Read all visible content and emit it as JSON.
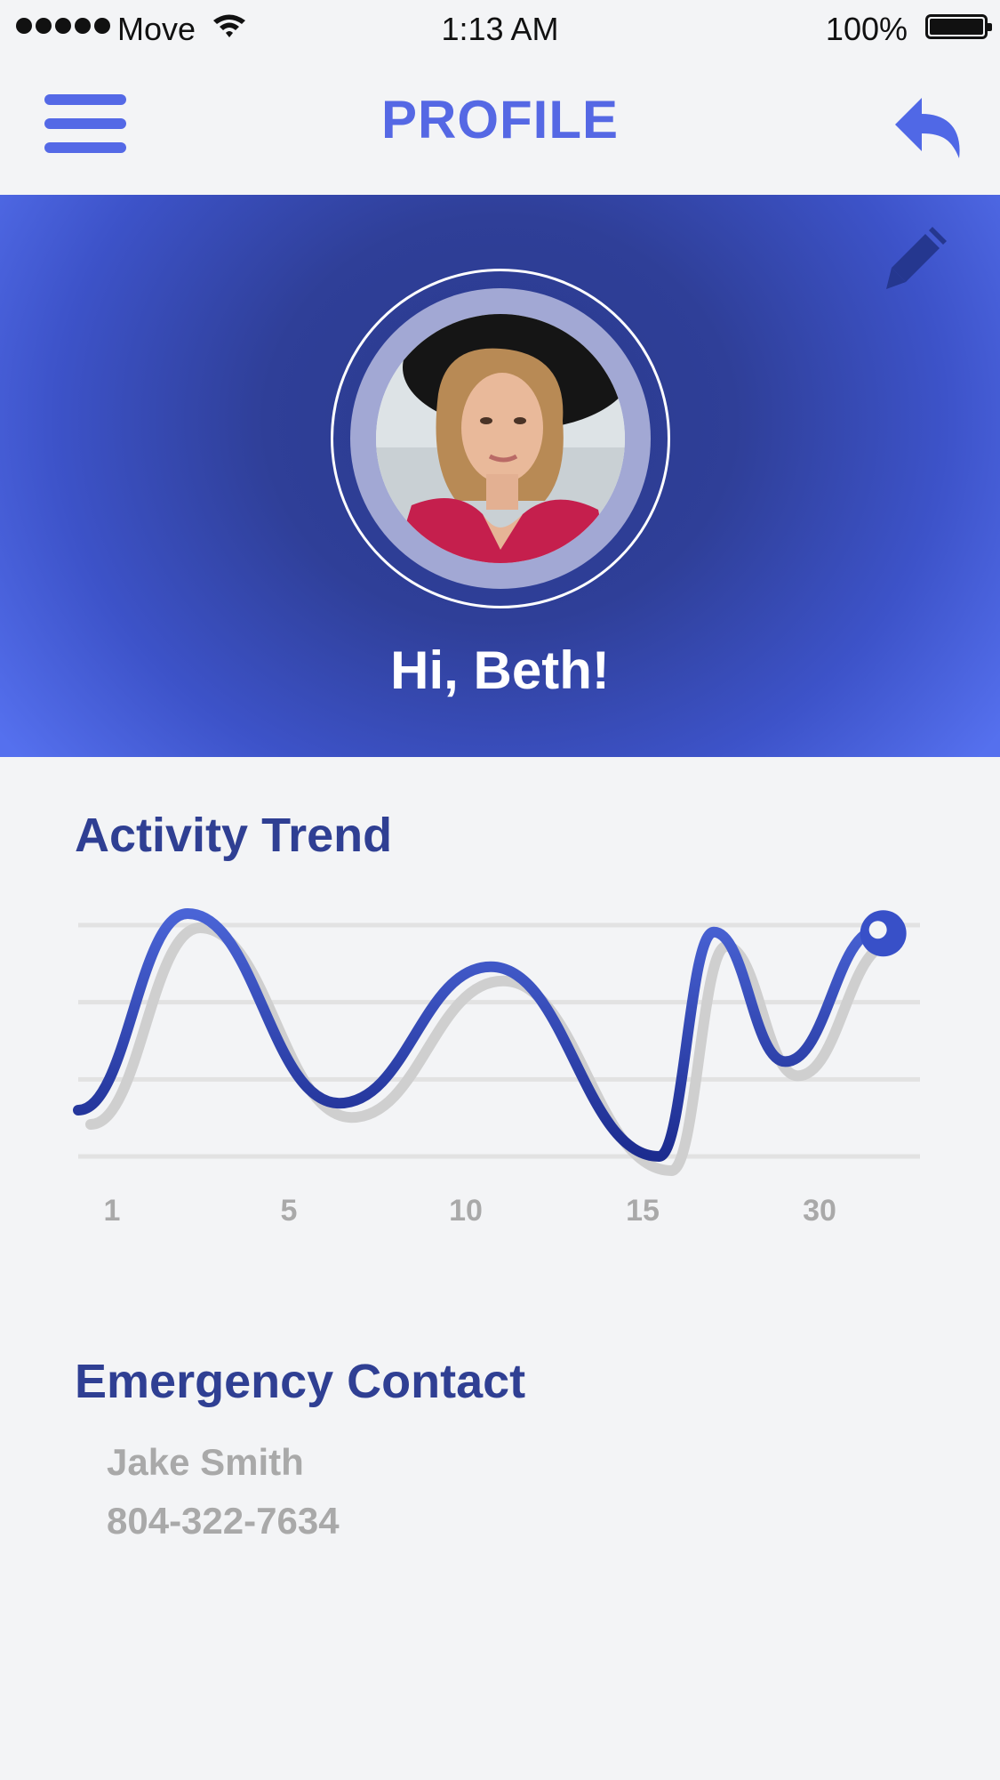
{
  "status_bar": {
    "carrier": "Move",
    "time": "1:13 AM",
    "battery": "100%"
  },
  "nav": {
    "title": "PROFILE",
    "menu_icon": "hamburger-icon",
    "back_icon": "reply-arrow-icon"
  },
  "profile": {
    "greeting": "Hi, Beth!",
    "edit_icon": "pencil-icon",
    "avatar_alt": "profile photo"
  },
  "activity": {
    "title": "Activity Trend"
  },
  "chart_data": {
    "type": "line",
    "x_ticks": [
      "1",
      "5",
      "10",
      "15",
      "30"
    ],
    "series": [
      {
        "x": [
          0,
          0.13,
          0.31,
          0.49,
          0.69,
          0.755,
          0.84,
          0.95
        ],
        "values": [
          0.2,
          1.05,
          0.23,
          0.82,
          0.0,
          0.97,
          0.41,
          0.98
        ]
      }
    ],
    "ylim": [
      0,
      1
    ],
    "grid": true,
    "line_color_start": "#1c2c8f",
    "line_color_end": "#4a64d6",
    "shadow_color": "#cfcfcf"
  },
  "emergency": {
    "title": "Emergency Contact",
    "name": "Jake Smith",
    "phone": "804-322-7634"
  },
  "colors": {
    "accent": "#5568e4",
    "dark_blue": "#2f3f93",
    "background": "#f3f4f6",
    "muted_text": "#a9a9a9"
  }
}
